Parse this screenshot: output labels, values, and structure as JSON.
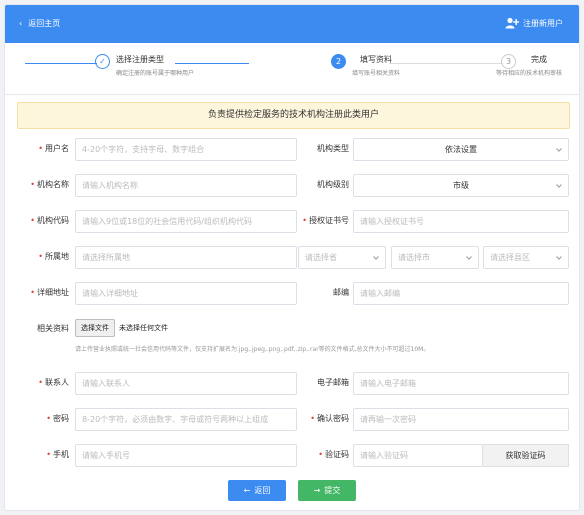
{
  "header": {
    "back_label": "返回主页",
    "register_label": "注册新用户"
  },
  "steps": [
    {
      "number": "✓",
      "title": "选择注册类型",
      "desc": "确定注册的账号属于哪种用户"
    },
    {
      "number": "2",
      "title": "填写资料",
      "desc": "填写账号相关资料"
    },
    {
      "number": "3",
      "title": "完成",
      "desc": "等待相应的技术机构审核"
    }
  ],
  "notice": "负责提供检定服务的技术机构注册此类用户",
  "form": {
    "username": {
      "label": "用户名",
      "placeholder": "4-20个字符，支持字母、数字组合"
    },
    "org_type": {
      "label": "机构类型",
      "value": "依法设置"
    },
    "org_name": {
      "label": "机构名称",
      "placeholder": "请输入机构名称"
    },
    "org_level": {
      "label": "机构级别",
      "value": "市级"
    },
    "org_code": {
      "label": "机构代码",
      "placeholder": "请输入9位或18位的社会信用代码/组织机构代码"
    },
    "cert_no": {
      "label": "授权证书号",
      "placeholder": "请输入授权证书号"
    },
    "location": {
      "label": "所属地",
      "placeholder": "请选择所属地"
    },
    "province": {
      "placeholder": "请选择省"
    },
    "city": {
      "placeholder": "请选择市"
    },
    "district": {
      "placeholder": "请选择县区"
    },
    "address": {
      "label": "详细地址",
      "placeholder": "请输入详细地址"
    },
    "postcode": {
      "label": "邮编",
      "placeholder": "请输入邮编"
    },
    "docs": {
      "label": "相关资料",
      "button": "选择文件",
      "status": "未选择任何文件",
      "hint": "请上传营业执照或统一社会信用代码等文件，仅支持扩展名为.jpg,.jpeg,.png,.pdf,.zip,.rar等的文件格式,总文件大小不可超过10M。"
    },
    "contact": {
      "label": "联系人",
      "placeholder": "请输入联系人"
    },
    "email": {
      "label": "电子邮箱",
      "placeholder": "请输入电子邮箱"
    },
    "password": {
      "label": "密码",
      "placeholder": "8-20个字符，必须由数字、字母或符号两种以上组成"
    },
    "confirm_password": {
      "label": "确认密码",
      "placeholder": "请再输一次密码"
    },
    "phone": {
      "label": "手机",
      "placeholder": "请输入手机号"
    },
    "captcha": {
      "label": "验证码",
      "placeholder": "请输入验证码",
      "button": "获取验证码"
    }
  },
  "actions": {
    "back": "返回",
    "submit": "提交"
  },
  "colors": {
    "primary": "#3b8bf0",
    "success": "#43b766",
    "required": "#e03b3b",
    "notice_bg": "#fef5dd"
  }
}
